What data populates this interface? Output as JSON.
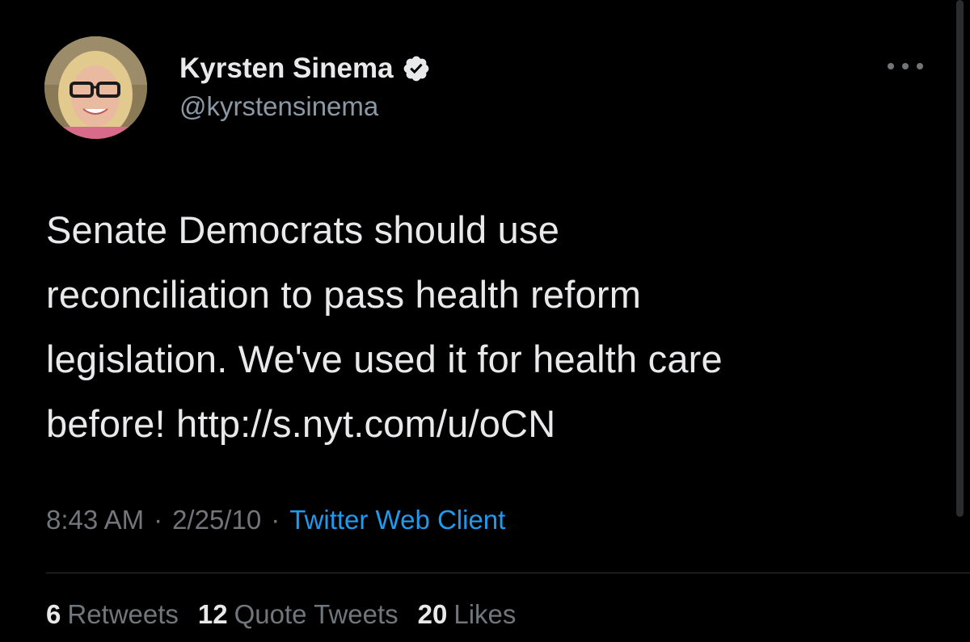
{
  "tweet": {
    "author": {
      "display_name": "Kyrsten Sinema",
      "handle": "@kyrstensinema",
      "verified": true
    },
    "text_lines": [
      "Senate Democrats should use",
      "reconciliation to pass health reform",
      "legislation. We've used it for health care",
      "before!  http://s.nyt.com/u/oCN"
    ],
    "time": "8:43 AM",
    "date": "2/25/10",
    "separator": "·",
    "source": "Twitter Web Client",
    "stats": {
      "retweets_count": "6",
      "retweets_label": "Retweets",
      "quotes_count": "12",
      "quotes_label": "Quote Tweets",
      "likes_count": "20",
      "likes_label": "Likes"
    }
  },
  "icons": {
    "verified": "verified-badge-icon",
    "more": "more-horizontal-icon"
  },
  "colors": {
    "background": "#000000",
    "text": "#e7e9ea",
    "secondary": "#71767b",
    "link": "#1d9bf0",
    "divider": "#2f3336"
  }
}
